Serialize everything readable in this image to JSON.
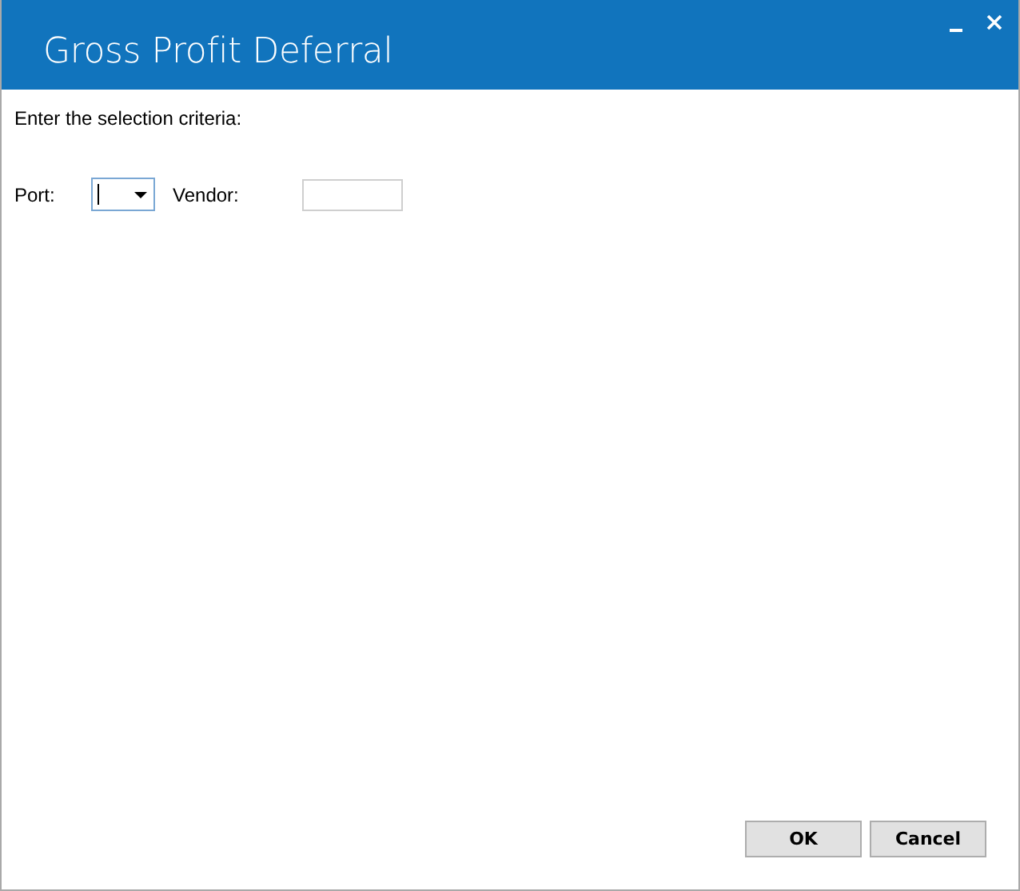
{
  "window": {
    "title": "Gross Profit Deferral"
  },
  "prompt": "Enter the selection criteria:",
  "fields": [
    {
      "kind": "combo",
      "label": "Port:",
      "focused": true
    },
    {
      "kind": "text",
      "label": "Vendor:",
      "focused": false
    }
  ],
  "buttons": [
    "OK",
    "Cancel"
  ]
}
